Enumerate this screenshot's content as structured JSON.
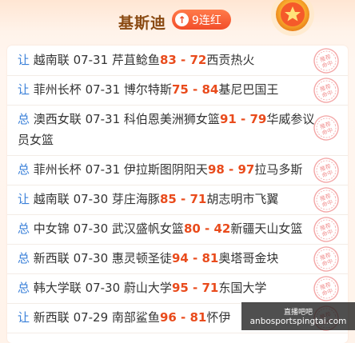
{
  "header": {
    "expert_name": "基斯迪",
    "streak_label": "9连红",
    "streak_icon": "arrow-up-icon",
    "medal_icon": "star-medal-icon"
  },
  "colors": {
    "accent": "#f24d2a",
    "score": "#e94b1c",
    "tag": "#3a80d9",
    "name": "#8a4a12"
  },
  "stamp_text": "推荐命中",
  "matches": [
    {
      "tag": "让",
      "league": "越南联",
      "date": "07-31",
      "home": "芹苴鲶鱼",
      "home_score": "83",
      "sep": "-",
      "away_score": "72",
      "away": "西贡热火"
    },
    {
      "tag": "让",
      "league": "菲州长杯",
      "date": "07-31",
      "home": "博尔特斯",
      "home_score": "75",
      "sep": "-",
      "away_score": "84",
      "away": "基尼巴国王"
    },
    {
      "tag": "总",
      "league": "澳西女联",
      "date": "07-31",
      "home": "科伯恩美洲狮女篮",
      "home_score": "91",
      "sep": "-",
      "away_score": "79",
      "away": "华威参议员女篮"
    },
    {
      "tag": "总",
      "league": "菲州长杯",
      "date": "07-31",
      "home": "伊拉斯图阴阳天",
      "home_score": "98",
      "sep": "-",
      "away_score": "97",
      "away": "拉马多斯"
    },
    {
      "tag": "让",
      "league": "越南联",
      "date": "07-30",
      "home": "芽庄海豚",
      "home_score": "85",
      "sep": "-",
      "away_score": "71",
      "away": "胡志明市飞翼"
    },
    {
      "tag": "总",
      "league": "中女锦",
      "date": "07-30",
      "home": "武汉盛帆女篮",
      "home_score": "80",
      "sep": "-",
      "away_score": "42",
      "away": "新疆天山女篮"
    },
    {
      "tag": "总",
      "league": "新西联",
      "date": "07-30",
      "home": "惠灵顿圣徒",
      "home_score": "94",
      "sep": "-",
      "away_score": "81",
      "away": "奥塔哥金块"
    },
    {
      "tag": "总",
      "league": "韩大学联",
      "date": "07-30",
      "home": "蔚山大学",
      "home_score": "95",
      "sep": "-",
      "away_score": "71",
      "away": "东国大学"
    },
    {
      "tag": "让",
      "league": "新西联",
      "date": "07-29",
      "home": "南部鲨鱼",
      "home_score": "96",
      "sep": "-",
      "away_score": "81",
      "away": "怀伊"
    }
  ],
  "watermark": {
    "line1": "直播吧吧",
    "line2": "anbosportspingtai.com"
  }
}
